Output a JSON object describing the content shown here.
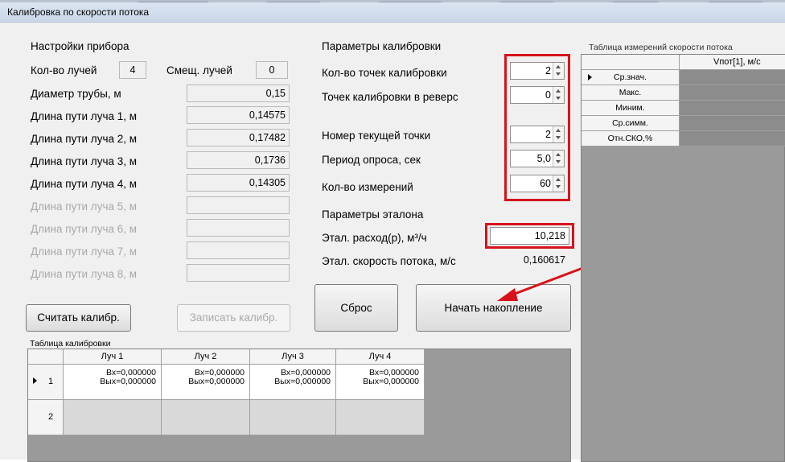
{
  "window": {
    "title": "Калибровка по скорости потока"
  },
  "device": {
    "group_title": "Настройки прибора",
    "beams_label": "Кол-во лучей",
    "beams_value": "4",
    "offset_label": "Смещ. лучей",
    "offset_value": "0",
    "diameter_label": "Диаметр трубы, м",
    "diameter_value": "0,15",
    "paths": [
      {
        "label": "Длина пути луча 1, м",
        "value": "0,14575",
        "enabled": true
      },
      {
        "label": "Длина пути луча 2, м",
        "value": "0,17482",
        "enabled": true
      },
      {
        "label": "Длина пути луча 3, м",
        "value": "0,1736",
        "enabled": true
      },
      {
        "label": "Длина пути луча 4, м",
        "value": "0,14305",
        "enabled": true
      },
      {
        "label": "Длина пути луча 5, м",
        "value": "",
        "enabled": false
      },
      {
        "label": "Длина пути луча 6, м",
        "value": "",
        "enabled": false
      },
      {
        "label": "Длина пути луча 7, м",
        "value": "",
        "enabled": false
      },
      {
        "label": "Длина пути луча 8, м",
        "value": "",
        "enabled": false
      }
    ]
  },
  "calibration": {
    "group_title": "Параметры калибровки",
    "points_label": "Кол-во точек калибровки",
    "points_value": "2",
    "reverse_label": "Точек калибровки в реверс",
    "reverse_value": "0",
    "current_label": "Номер текущей точки",
    "current_value": "2",
    "period_label": "Период опроса, сек",
    "period_value": "5,0",
    "measures_label": "Кол-во измерений",
    "measures_value": "60"
  },
  "reference": {
    "group_title": "Параметры эталона",
    "flow_label": "Этал. расход(р), м³/ч",
    "flow_value": "10,218",
    "speed_label": "Этал. скорость потока, м/с",
    "speed_value": "0,160617"
  },
  "buttons": {
    "read": "Считать калибр.",
    "write": "Записать калибр.",
    "reset": "Сброс",
    "start": "Начать накопление"
  },
  "calib_table": {
    "title": "Таблица калибровки",
    "columns": [
      "Луч 1",
      "Луч 2",
      "Луч 3",
      "Луч 4"
    ],
    "rows": [
      {
        "num": "1",
        "cells": [
          [
            "Вх=0,000000",
            "Вых=0,000000"
          ],
          [
            "Вх=0,000000",
            "Вых=0,000000"
          ],
          [
            "Вх=0,000000",
            "Вых=0,000000"
          ],
          [
            "Вх=0,000000",
            "Вых=0,000000"
          ]
        ]
      },
      {
        "num": "2",
        "cells": []
      }
    ]
  },
  "flow_table": {
    "title": "Таблица измерений скорости потока",
    "column": "Vпот[1], м/с",
    "rows": [
      "Ср.знач.",
      "Макс.",
      "Миним.",
      "Ср.симм.",
      "Отн.СКО,%"
    ]
  },
  "colors": {
    "highlight": "#d8121a",
    "arrow": "#d8121a"
  }
}
